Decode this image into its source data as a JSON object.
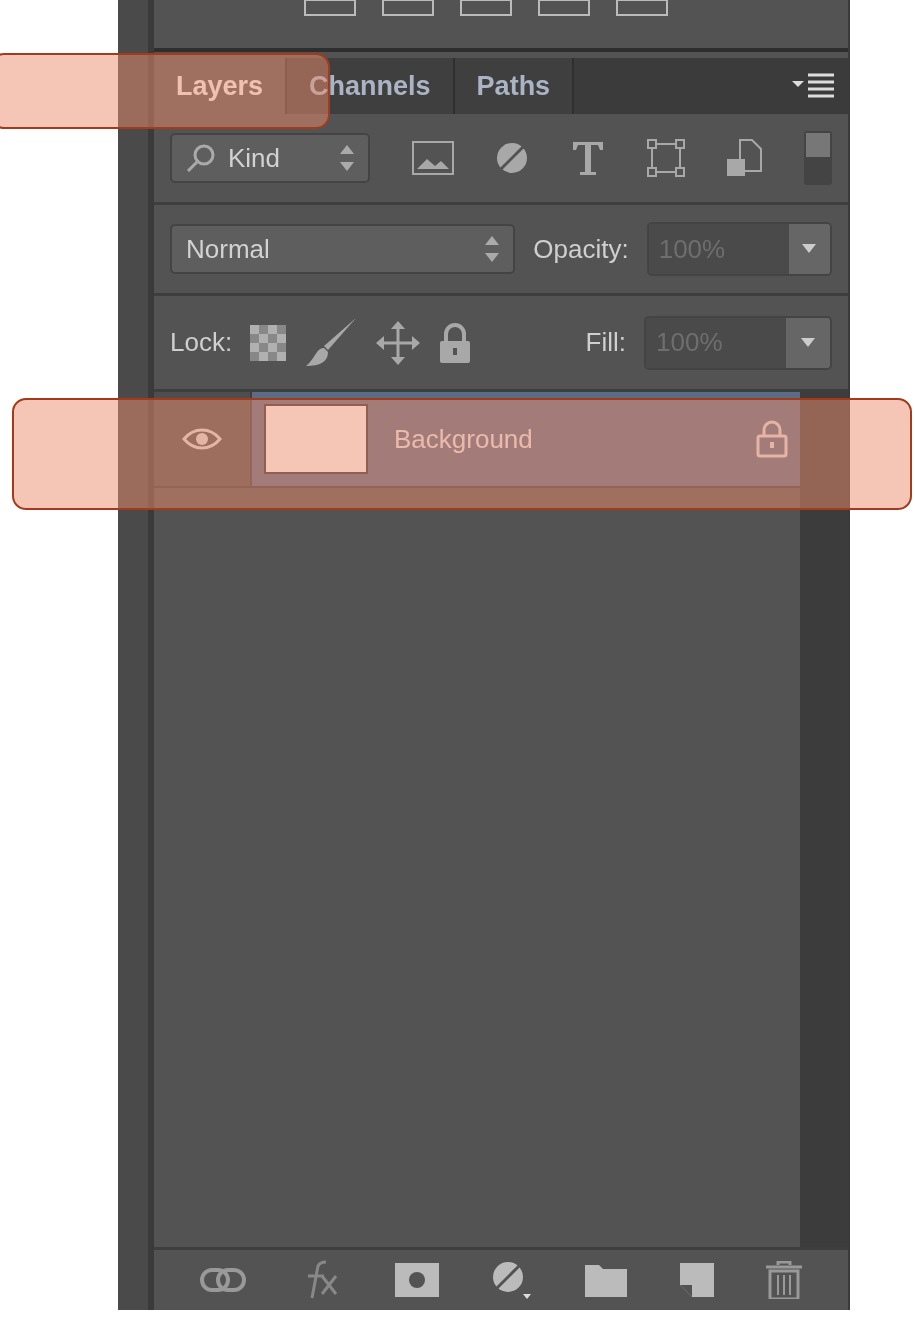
{
  "tabs": [
    {
      "label": "Layers",
      "selected": true
    },
    {
      "label": "Channels",
      "selected": false
    },
    {
      "label": "Paths",
      "selected": false
    }
  ],
  "filter": {
    "value": "Kind"
  },
  "blend_mode": {
    "value": "Normal"
  },
  "opacity": {
    "label": "Opacity:",
    "value": "100%",
    "disabled": true
  },
  "lock": {
    "label": "Lock:"
  },
  "fill": {
    "label": "Fill:",
    "value": "100%",
    "disabled": true
  },
  "layers": [
    {
      "name": "Background",
      "visible": true,
      "locked": true,
      "selected": true
    }
  ]
}
